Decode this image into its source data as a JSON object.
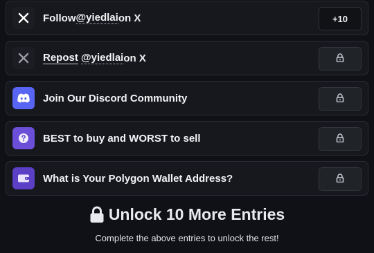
{
  "entries": [
    {
      "icon": "x-logo-icon",
      "prefix": "Follow ",
      "handle": "@yiedlai",
      "suffix": " on X",
      "action": "+10",
      "locked": false
    },
    {
      "icon": "x-logo-icon",
      "prefix": "Repost",
      "handle": "@yiedlai",
      "suffix": " on X",
      "action": "",
      "locked": true
    },
    {
      "icon": "discord-icon",
      "label": "Join Our Discord Community",
      "locked": true
    },
    {
      "icon": "question-icon",
      "label": "BEST to buy and WORST to sell",
      "locked": true
    },
    {
      "icon": "wallet-icon",
      "label": "What is Your Polygon Wallet Address?",
      "locked": true
    }
  ],
  "footer": {
    "title": "Unlock 10 More Entries",
    "subtitle": "Complete the above entries to unlock the rest!"
  },
  "colors": {
    "background": "#0f1116",
    "card": "#16181d",
    "discord": "#5865f2",
    "question": "#6b4fd8",
    "wallet": "#5b3fc4"
  }
}
